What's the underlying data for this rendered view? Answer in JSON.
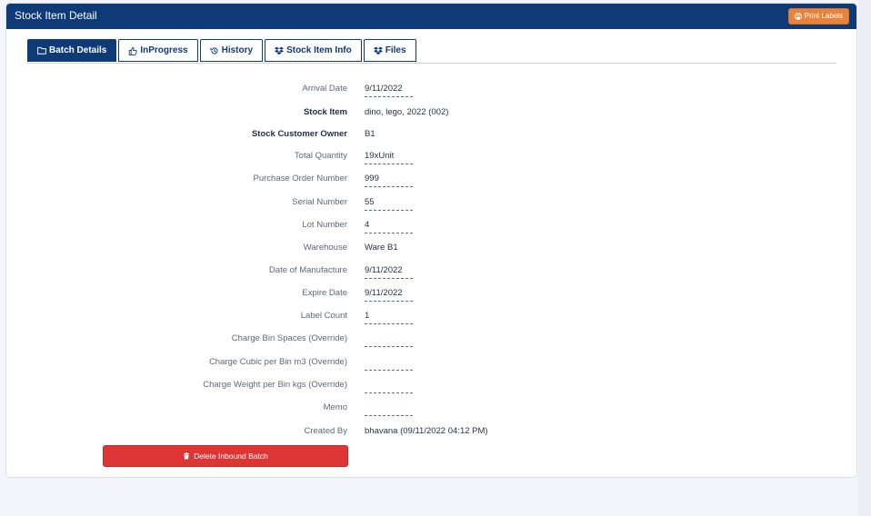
{
  "header": {
    "title": "Stock Item Detail",
    "print_label": "Print Labels"
  },
  "tabs": [
    {
      "label": "Batch Details",
      "icon": "folder-icon",
      "active": true
    },
    {
      "label": "InProgress",
      "icon": "thumbs-up-icon",
      "active": false
    },
    {
      "label": "History",
      "icon": "history-icon",
      "active": false
    },
    {
      "label": "Stock Item Info",
      "icon": "dropbox-icon",
      "active": false
    },
    {
      "label": "Files",
      "icon": "dropbox-icon",
      "active": false
    }
  ],
  "fields": [
    {
      "label": "Arrival Date",
      "value": "9/11/2022",
      "editable": true,
      "strong": false
    },
    {
      "label": "Stock Item",
      "value": "dino, lego, 2022 (002)",
      "editable": false,
      "strong": true
    },
    {
      "label": "Stock Customer Owner",
      "value": "B1",
      "editable": false,
      "strong": true
    },
    {
      "label": "Total Quantity",
      "value": "19xUnit",
      "editable": true,
      "strong": false
    },
    {
      "label": "Purchase Order Number",
      "value": "999",
      "editable": true,
      "strong": false
    },
    {
      "label": "Serial Number",
      "value": "55",
      "editable": true,
      "strong": false
    },
    {
      "label": "Lot Number",
      "value": "4",
      "editable": true,
      "strong": false
    },
    {
      "label": "Warehouse",
      "value": "Ware B1",
      "editable": false,
      "strong": false
    },
    {
      "label": "Date of Manufacture",
      "value": "9/11/2022",
      "editable": true,
      "strong": false
    },
    {
      "label": "Expire Date",
      "value": "9/11/2022",
      "editable": true,
      "strong": false
    },
    {
      "label": "Label Count",
      "value": "1",
      "editable": true,
      "strong": false
    },
    {
      "label": "Charge Bin Spaces (Override)",
      "value": "",
      "editable": true,
      "strong": false
    },
    {
      "label": "Charge Cubic per Bin m3 (Override)",
      "value": "",
      "editable": true,
      "strong": false
    },
    {
      "label": "Charge Weight per Bin kgs (Override)",
      "value": "",
      "editable": true,
      "strong": false
    },
    {
      "label": "Memo",
      "value": "",
      "editable": true,
      "strong": false
    },
    {
      "label": "Created By",
      "value": "bhavana (09/11/2022 04:12 PM)",
      "editable": false,
      "strong": false
    }
  ],
  "actions": {
    "delete_label": "Delete Inbound Batch"
  },
  "colors": {
    "header_bg": "#0e3a78",
    "print_button": "#e8833a",
    "delete_button": "#dd3434"
  }
}
